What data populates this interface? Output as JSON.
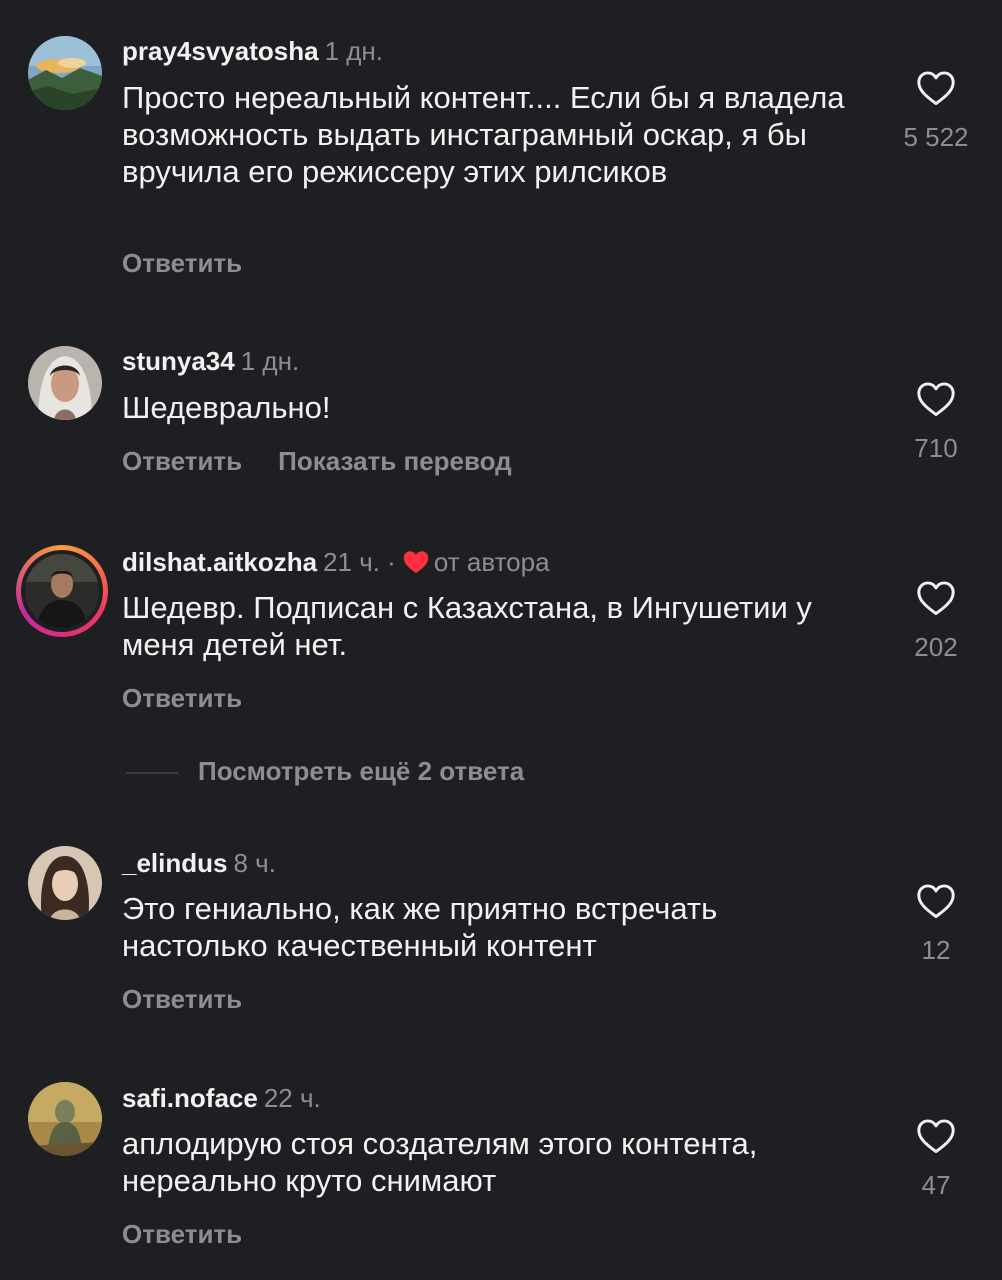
{
  "comments": [
    {
      "username": "pray4svyatosha",
      "time": "1 дн.",
      "text": "Просто нереальный контент.... Если бы я владела возможность выдать инстаграмный оскар, я бы вручила его режиссеру этих рилсиков",
      "reply": "Ответить",
      "likes": "5 522",
      "avatar_icon": "landscape-avatar"
    },
    {
      "username": "stunya34",
      "time": "1 дн.",
      "text": "Шедеврально!",
      "reply": "Ответить",
      "translate": "Показать перевод",
      "likes": "710",
      "avatar_icon": "person-avatar"
    },
    {
      "username": "dilshat.aitkozha",
      "time": "21 ч. ·",
      "author_label": "от автора",
      "text": "Шедевр. Подписан с Казахстана, в Ингушетии у меня детей нет.",
      "reply": "Ответить",
      "likes": "202",
      "avatar_icon": "person-avatar-story-ring"
    },
    {
      "username": "_elindus",
      "time": "8 ч.",
      "text": "Это гениально, как же приятно встречать настолько качественный контент",
      "reply": "Ответить",
      "likes": "12",
      "avatar_icon": "person-avatar"
    },
    {
      "username": "safi.noface",
      "time": "22 ч.",
      "text": "аплодирую стоя создателям этого контента, нереально круто снимают",
      "reply": "Ответить",
      "likes": "47",
      "avatar_icon": "painting-avatar"
    }
  ],
  "view_more_replies": "Посмотреть ещё 2 ответа",
  "colors": {
    "background": "#1e1f23",
    "text": "#f2f2f2",
    "secondary": "#8d8e93",
    "author_heart": "#ff3040"
  }
}
